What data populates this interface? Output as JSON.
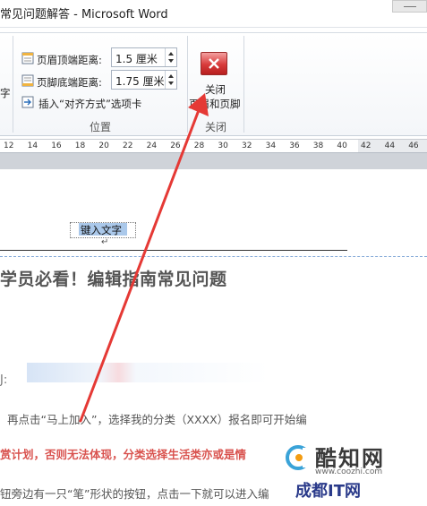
{
  "window": {
    "title": "常见问题解答 - Microsoft Word"
  },
  "ribbon": {
    "left_partial_label": "字",
    "header_top_label": "页眉顶端距离:",
    "header_top_value": "1.5 厘米",
    "footer_bottom_label": "页脚底端距离:",
    "footer_bottom_value": "1.75 厘米",
    "insert_align_tab_label": "插入“对齐方式”选项卡",
    "position_group_label": "位置",
    "close_button_line1": "关闭",
    "close_button_line2": "页眉和页脚",
    "close_group_label": "关闭"
  },
  "ruler": {
    "ticks": [
      "12",
      "14",
      "16",
      "18",
      "20",
      "22",
      "24",
      "26",
      "28",
      "30",
      "32",
      "34",
      "36",
      "38",
      "40",
      "42",
      "44",
      "46"
    ]
  },
  "document": {
    "header_placeholder": "键入文字",
    "paragraph_mark": "↵",
    "heading": "学员必看！编辑指南常见问题",
    "meta_label": "J:",
    "line1": "再点击“马上加入”，选择我的分类（XXXX）报名即可开始编",
    "line2": "赏计划，否则无法体现，分类选择生活类亦或是情",
    "line3": "钮旁边有一只“笔”形状的按钮，点击一下就可以进入编"
  },
  "watermark": {
    "logo_text": "酷知网",
    "url": "www.coozhi.com",
    "secondary_text": "成都IT网"
  },
  "colors": {
    "arrow": "#e53935",
    "red_text": "#d9534f",
    "close_button": "#d83a3a"
  },
  "icons": {
    "close": "close-icon",
    "header_top": "header-top-icon",
    "footer_bottom": "footer-bottom-icon",
    "insert_tab": "insert-align-tab-icon"
  }
}
